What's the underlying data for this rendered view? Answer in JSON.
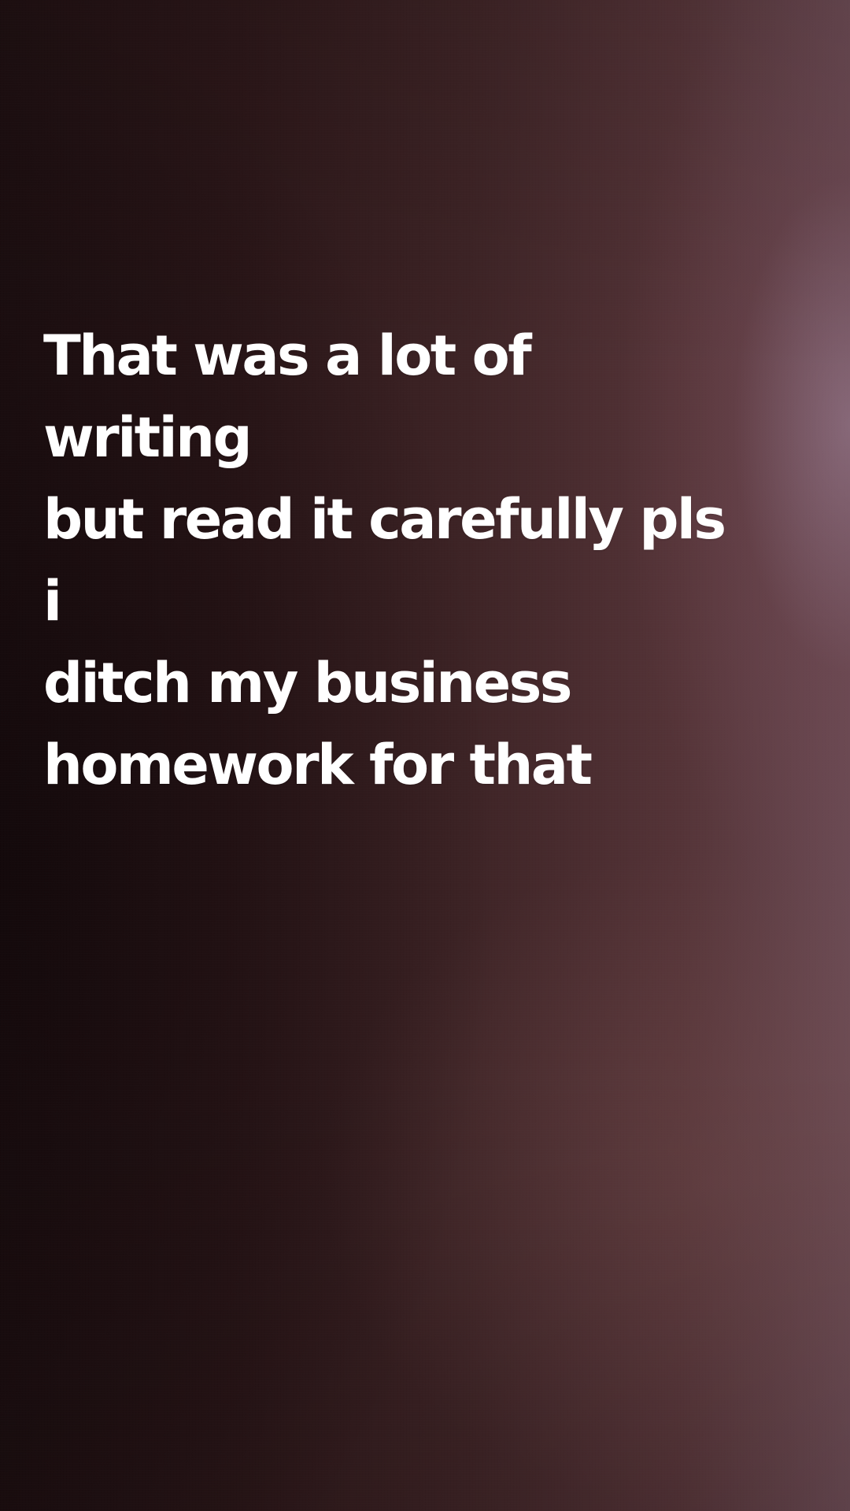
{
  "story": {
    "text": "That was a lot of writing\nbut read it carefully pls i\nditch my business\nhomework for that"
  },
  "colors": {
    "text": "#ffffff",
    "background_dark": "#1f1012",
    "background_light": "#6b4b54"
  }
}
